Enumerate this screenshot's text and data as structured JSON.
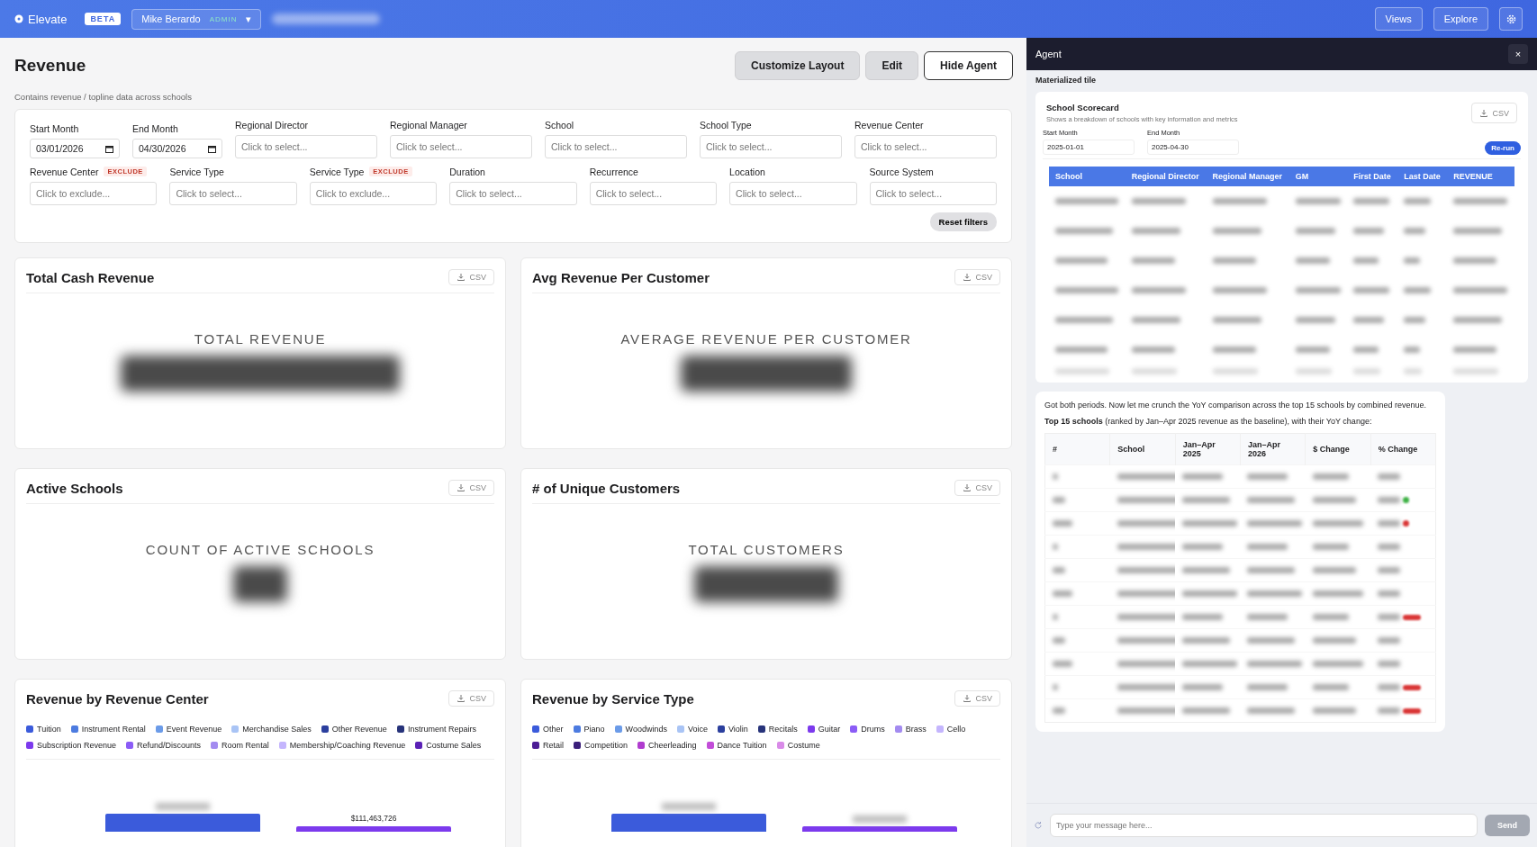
{
  "header": {
    "logo": "Elevate",
    "beta": "BETA",
    "user": "Mike Berardo",
    "role": "ADMIN",
    "caret": "▾",
    "nav": [
      "Views",
      "Explore"
    ]
  },
  "page": {
    "title": "Revenue",
    "subtitle": "Contains revenue / topline data across schools",
    "actions": [
      "Customize Layout",
      "Edit",
      "Hide Agent"
    ]
  },
  "filters": {
    "rows": [
      [
        {
          "kind": "date",
          "label": "Start Month",
          "value": "03/01/2026"
        },
        {
          "kind": "date",
          "label": "End Month",
          "value": "04/30/2026"
        },
        {
          "kind": "select",
          "label": "Regional Director",
          "placeholder": "Click to select...",
          "exclude": false
        },
        {
          "kind": "select",
          "label": "Regional Manager",
          "placeholder": "Click to select...",
          "exclude": false
        },
        {
          "kind": "select",
          "label": "School",
          "placeholder": "Click to select...",
          "exclude": false
        },
        {
          "kind": "select",
          "label": "School Type",
          "placeholder": "Click to select...",
          "exclude": false
        },
        {
          "kind": "select",
          "label": "Revenue Center",
          "placeholder": "Click to select...",
          "exclude": false
        }
      ],
      [
        {
          "kind": "select",
          "label": "Revenue Center",
          "badge": "EXCLUDE",
          "placeholder": "Click to exclude...",
          "exclude": true
        },
        {
          "kind": "select",
          "label": "Service Type",
          "placeholder": "Click to select...",
          "exclude": false
        },
        {
          "kind": "select",
          "label": "Service Type",
          "badge": "EXCLUDE",
          "placeholder": "Click to exclude...",
          "exclude": true
        },
        {
          "kind": "select",
          "label": "Duration",
          "placeholder": "Click to select...",
          "exclude": false
        },
        {
          "kind": "select",
          "label": "Recurrence",
          "placeholder": "Click to select...",
          "exclude": false
        },
        {
          "kind": "select",
          "label": "Location",
          "placeholder": "Click to select...",
          "exclude": false
        },
        {
          "kind": "select",
          "label": "Source System",
          "placeholder": "Click to select...",
          "exclude": false
        }
      ]
    ],
    "reset": "Reset filters"
  },
  "kpis": [
    {
      "title": "Total Cash Revenue",
      "csv": "CSV",
      "caption": "TOTAL REVENUE"
    },
    {
      "title": "Avg Revenue Per Customer",
      "csv": "CSV",
      "caption": "AVERAGE REVENUE PER CUSTOMER"
    },
    {
      "title": "Active Schools",
      "csv": "CSV",
      "caption": "COUNT OF ACTIVE SCHOOLS"
    },
    {
      "title": "# of Unique Customers",
      "csv": "CSV",
      "caption": "TOTAL CUSTOMERS"
    }
  ],
  "charts": [
    {
      "title": "Revenue by Revenue Center",
      "csv": "CSV",
      "bar_value_label": "$111,463,726",
      "legend": [
        {
          "label": "Tuition",
          "color": "#3b5bdb"
        },
        {
          "label": "Instrument Rental",
          "color": "#4c7be0"
        },
        {
          "label": "Event Revenue",
          "color": "#6b9be8"
        },
        {
          "label": "Merchandise Sales",
          "color": "#a9c4f5"
        },
        {
          "label": "Other Revenue",
          "color": "#2b3f9e"
        },
        {
          "label": "Instrument Repairs",
          "color": "#27337a"
        },
        {
          "label": "Subscription Revenue",
          "color": "#7c3aed"
        },
        {
          "label": "Refund/Discounts",
          "color": "#8b5cf6"
        },
        {
          "label": "Room Rental",
          "color": "#a38bf0"
        },
        {
          "label": "Membership/Coaching Revenue",
          "color": "#c4b5fd"
        },
        {
          "label": "Costume Sales",
          "color": "#5b21b6"
        }
      ]
    },
    {
      "title": "Revenue by Service Type",
      "csv": "CSV",
      "legend": [
        {
          "label": "Other",
          "color": "#3b5bdb"
        },
        {
          "label": "Piano",
          "color": "#4c7be0"
        },
        {
          "label": "Woodwinds",
          "color": "#6b9be8"
        },
        {
          "label": "Voice",
          "color": "#a9c4f5"
        },
        {
          "label": "Violin",
          "color": "#2b3f9e"
        },
        {
          "label": "Recitals",
          "color": "#27337a"
        },
        {
          "label": "Guitar",
          "color": "#7c3aed"
        },
        {
          "label": "Drums",
          "color": "#8b5cf6"
        },
        {
          "label": "Brass",
          "color": "#a38bf0"
        },
        {
          "label": "Cello",
          "color": "#c4b5fd"
        },
        {
          "label": "Retail",
          "color": "#4c1d95"
        },
        {
          "label": "Competition",
          "color": "#3b1f7a"
        },
        {
          "label": "Cheerleading",
          "color": "#b03ccf"
        },
        {
          "label": "Dance Tuition",
          "color": "#c24dd8"
        },
        {
          "label": "Costume",
          "color": "#d98be8"
        }
      ]
    }
  ],
  "agent": {
    "title": "Agent",
    "close": "×",
    "section": "Materialized tile",
    "tile": {
      "title": "School Scorecard",
      "description": "Shows a breakdown of schools with key information and metrics",
      "csv": "CSV",
      "start_label": "Start Month",
      "start_value": "2025-01-01",
      "end_label": "End Month",
      "end_value": "2025-04-30",
      "rerun": "Re-run",
      "columns": [
        "School",
        "Regional Director",
        "Regional Manager",
        "GM",
        "First Date",
        "Last Date",
        "REVENUE"
      ]
    },
    "message": {
      "intro": "Got both periods. Now let me crunch the YoY comparison across the top 15 schools by combined revenue.",
      "lead": "**Top 15 schools** (ranked by Jan–Apr 2025 revenue as the baseline), with their YoY change:",
      "columns": [
        "#",
        "School",
        "Jan–Apr 2025",
        "Jan–Apr 2026",
        "$ Change",
        "% Change"
      ],
      "rows": [
        {
          "kind": "plain"
        },
        {
          "kind": "dot",
          "color": "#3cb043"
        },
        {
          "kind": "dot",
          "color": "#d93636"
        },
        {
          "kind": "plain"
        },
        {
          "kind": "plain"
        },
        {
          "kind": "plain"
        },
        {
          "kind": "badge",
          "color": "#d93636"
        },
        {
          "kind": "plain"
        },
        {
          "kind": "plain"
        },
        {
          "kind": "badge",
          "color": "#d93636"
        },
        {
          "kind": "badge",
          "color": "#d93636"
        }
      ]
    },
    "input": {
      "placeholder": "Type your message here..."
    },
    "send": {
      "label": "Send",
      "disabled": true
    }
  }
}
